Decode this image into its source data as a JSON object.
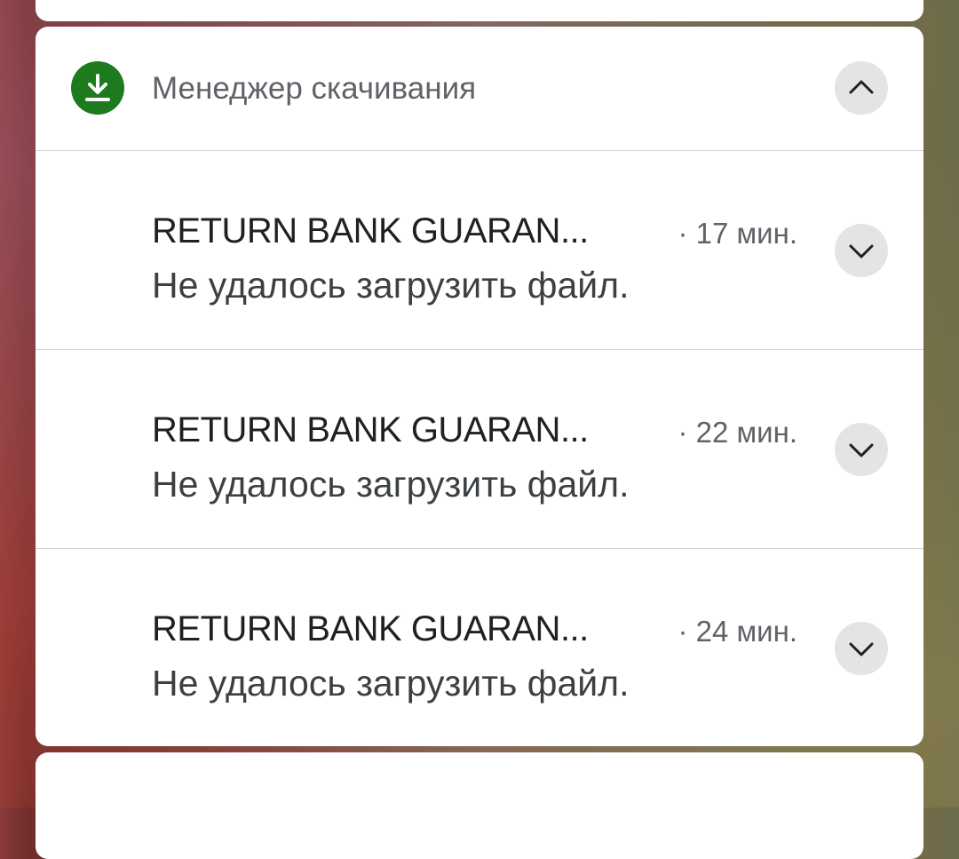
{
  "group": {
    "app_name": "Менеджер скачивания",
    "app_icon": "download-icon",
    "accent_color": "#1d7a1d",
    "collapse_icon": "chevron-up-icon"
  },
  "notifications": [
    {
      "title": "RETURN BANK GUARAN...",
      "time": "· 17 мин.",
      "message": "Не удалось загрузить файл.",
      "expand_icon": "chevron-down-icon"
    },
    {
      "title": "RETURN BANK GUARAN...",
      "time": "· 22 мин.",
      "message": "Не удалось загрузить файл.",
      "expand_icon": "chevron-down-icon"
    },
    {
      "title": "RETURN BANK GUARAN...",
      "time": "· 24 мин.",
      "message": "Не удалось загрузить файл.",
      "expand_icon": "chevron-down-icon"
    }
  ]
}
